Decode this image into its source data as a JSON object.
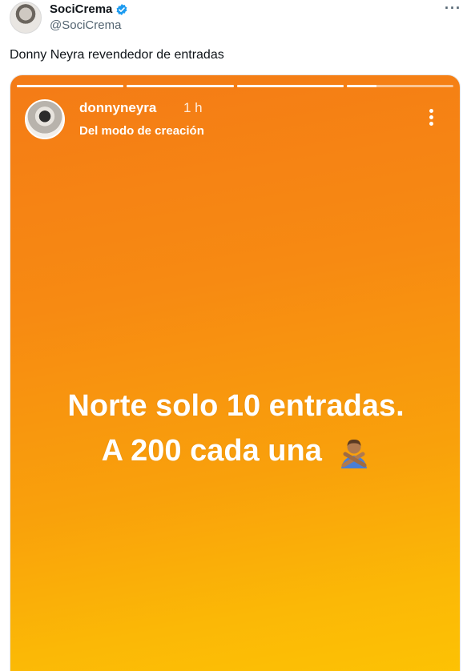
{
  "tweet": {
    "author": "SociCrema",
    "handle": "@SociCrema",
    "more_label": "···",
    "text": "Donny Neyra revendedor de entradas"
  },
  "story": {
    "username": "donnyneyra",
    "time": "1 h",
    "subtitle": "Del modo de creación",
    "line1": "Norte solo 10 entradas.",
    "line2": "A 200 cada una",
    "progress_segments": [
      1.0,
      1.0,
      1.0,
      0.28
    ],
    "background_colors": [
      "#f47b16",
      "#fdc304"
    ],
    "emoji_icon": "person-gesturing-no-icon"
  },
  "colors": {
    "verified": "#1d9bf0",
    "text_primary": "#0f1419",
    "text_secondary": "#536471"
  }
}
